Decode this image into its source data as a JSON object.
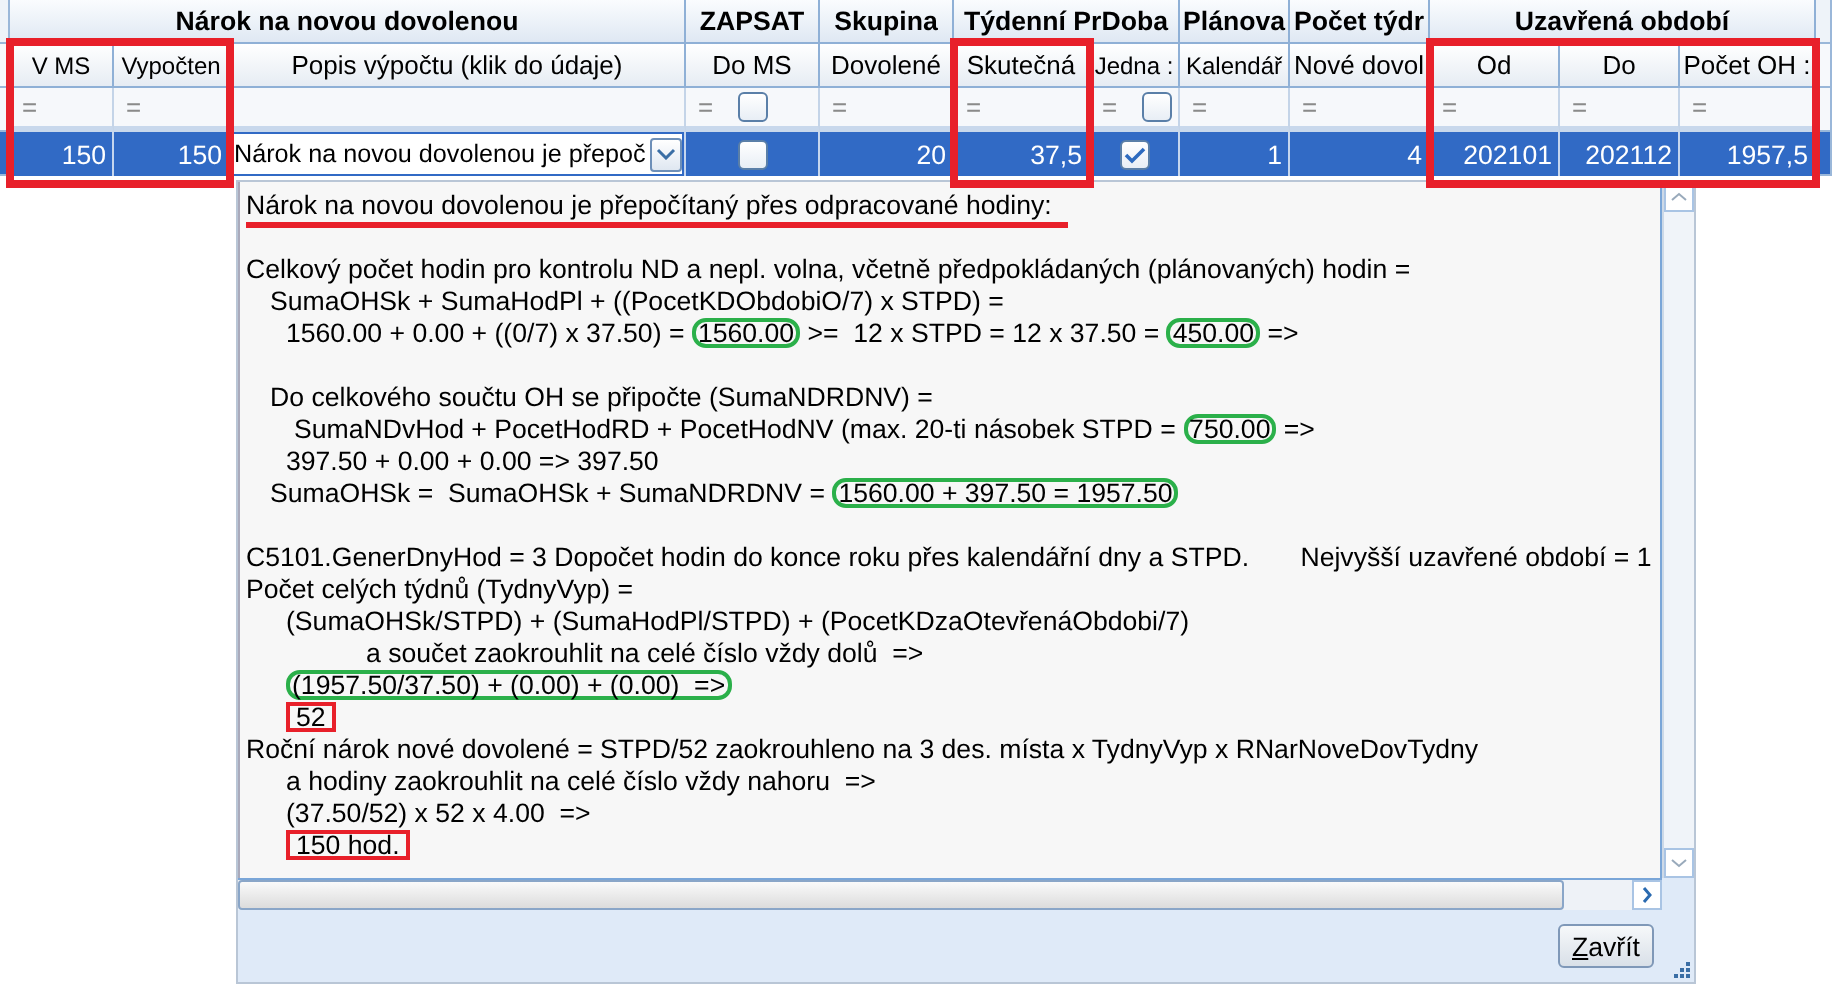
{
  "table": {
    "groups": [
      {
        "label": "Nárok na novou dovolenou",
        "columns": [
          {
            "header": "V MS",
            "filter": "=",
            "marked": true
          },
          {
            "header": "Vypočten",
            "filter": "=",
            "marked": true
          },
          {
            "header": "Popis výpočtu (klik do údaje)",
            "marked": false
          }
        ]
      },
      {
        "label": "ZAPSAT",
        "columns": [
          {
            "header": "Do MS",
            "filter": "=",
            "filter_checkbox": {
              "checked": false
            },
            "marked": false
          }
        ]
      },
      {
        "label": "Skupina",
        "columns": [
          {
            "header": "Dovolené",
            "filter": "=",
            "marked": false
          }
        ]
      },
      {
        "label": "Týdenní PrDoba",
        "columns": [
          {
            "header": "Skutečná",
            "filter": "=",
            "marked": true
          },
          {
            "header": "Jedna :",
            "filter": "=",
            "filter_checkbox": {
              "checked": false
            },
            "marked": false
          }
        ]
      },
      {
        "label": "Plánova",
        "columns": [
          {
            "header": "Kalendář",
            "filter": "=",
            "marked": false
          }
        ]
      },
      {
        "label": "Počet týdr",
        "columns": [
          {
            "header": "Nové dovol",
            "filter": "=",
            "marked": false
          }
        ]
      },
      {
        "label": "Uzavřená období",
        "columns": [
          {
            "header": "Od",
            "filter": "=",
            "marked": true
          },
          {
            "header": "Do",
            "filter": "=",
            "marked": true
          },
          {
            "header": "Počet OH :",
            "filter": "=",
            "marked": true
          }
        ]
      }
    ],
    "row": {
      "selected": true,
      "cells": [
        {
          "kind": "number",
          "text": "150"
        },
        {
          "kind": "number",
          "text": "150"
        },
        {
          "kind": "dropdown",
          "text": "Nárok na novou dovolenou je přepoč"
        },
        {
          "kind": "checkbox",
          "checked": false
        },
        {
          "kind": "number",
          "text": "20"
        },
        {
          "kind": "number",
          "text": "37,5"
        },
        {
          "kind": "checkbox",
          "checked": true
        },
        {
          "kind": "number",
          "text": "1"
        },
        {
          "kind": "number",
          "text": "4"
        },
        {
          "kind": "number",
          "text": "202101"
        },
        {
          "kind": "number",
          "text": "202112"
        },
        {
          "kind": "number",
          "text": "1957,5"
        }
      ]
    }
  },
  "detail": {
    "lines": [
      {
        "kind": "flush",
        "segments": [
          {
            "kind": "underlined",
            "text": "Nárok na novou dovolenou je přepočítaný přes odpracované hodiny:"
          }
        ]
      },
      {
        "kind": "blank"
      },
      {
        "kind": "flush",
        "segments": [
          {
            "kind": "plain",
            "text": "Celkový počet hodin pro kontrolu ND a nepl. volna, včetně předpokládaných (plánovaných) hodin ="
          }
        ]
      },
      {
        "kind": "small",
        "segments": [
          {
            "kind": "plain",
            "text": "SumaOHSk + SumaHodPl + ((PocetKDObdobiO/7) x STPD) ="
          }
        ]
      },
      {
        "kind": "medium",
        "segments": [
          {
            "kind": "plain",
            "text": "1560.00 + 0.00 + ((0/7) x 37.50) ="
          },
          {
            "kind": "ringed",
            "text": "1560.00"
          },
          {
            "kind": "plain",
            "text": ">=  12 x STPD = 12 x 37.50 ="
          },
          {
            "kind": "ringed",
            "text": "450.00"
          },
          {
            "kind": "plain",
            "text": "=>"
          }
        ]
      },
      {
        "kind": "blank"
      },
      {
        "kind": "small",
        "segments": [
          {
            "kind": "plain",
            "text": "Do celkového součtu OH se připočte (SumaNDRDNV) ="
          }
        ]
      },
      {
        "kind": "wide",
        "segments": [
          {
            "kind": "plain",
            "text": "SumaNDvHod + PocetHodRD + PocetHodNV (max. 20-ti násobek STPD ="
          },
          {
            "kind": "ringed",
            "text": "750.00"
          },
          {
            "kind": "plain",
            "text": "=>"
          }
        ]
      },
      {
        "kind": "medium",
        "segments": [
          {
            "kind": "plain",
            "text": "397.50 + 0.00 + 0.00 => 397.50"
          }
        ]
      },
      {
        "kind": "small",
        "segments": [
          {
            "kind": "plain",
            "text": "SumaOHSk =  SumaOHSk + SumaNDRDNV ="
          },
          {
            "kind": "ringed",
            "text": "1560.00 + 397.50 = 1957.50"
          }
        ]
      },
      {
        "kind": "blank"
      },
      {
        "kind": "flush",
        "segments": [
          {
            "kind": "plain",
            "text": "C5101.GenerDnyHod = 3 Dopočet hodin do konce roku přes kalendářní dny a STPD."
          },
          {
            "kind": "tabbed",
            "text": "Nejvyšší uzavřené období = 1"
          }
        ]
      },
      {
        "kind": "flush",
        "segments": [
          {
            "kind": "plain",
            "text": "Počet celých týdnů (TydnyVyp) ="
          }
        ]
      },
      {
        "kind": "medium",
        "segments": [
          {
            "kind": "plain",
            "text": "(SumaOHSk/STPD) + (SumaHodPl/STPD) + (PocetKDzaOtevřenáObdobi/7)"
          }
        ]
      },
      {
        "kind": "deep",
        "segments": [
          {
            "kind": "plain",
            "text": "a součet zaokrouhlit na celé číslo vždy dolů  =>"
          }
        ]
      },
      {
        "kind": "medium",
        "segments": [
          {
            "kind": "ringed",
            "text": "(1957.50/37.50) + (0.00) + (0.00)  =>"
          }
        ]
      },
      {
        "kind": "medium",
        "segments": [
          {
            "kind": "boxed",
            "text": "52"
          }
        ]
      },
      {
        "kind": "flush",
        "segments": [
          {
            "kind": "plain",
            "text": "Roční nárok nové dovolené = STPD/52 zaokrouhleno na 3 des. místa x TydnyVyp x RNarNoveDovTydny"
          }
        ]
      },
      {
        "kind": "medium",
        "segments": [
          {
            "kind": "plain",
            "text": "a hodiny zaokrouhlit na celé číslo vždy nahoru  =>"
          }
        ]
      },
      {
        "kind": "medium",
        "segments": [
          {
            "kind": "plain",
            "text": "(37.50/52) x 52 x 4.00  =>"
          }
        ]
      },
      {
        "kind": "medium",
        "segments": [
          {
            "kind": "boxed",
            "text": "150 hod."
          }
        ]
      }
    ],
    "button": "Zavřít"
  }
}
